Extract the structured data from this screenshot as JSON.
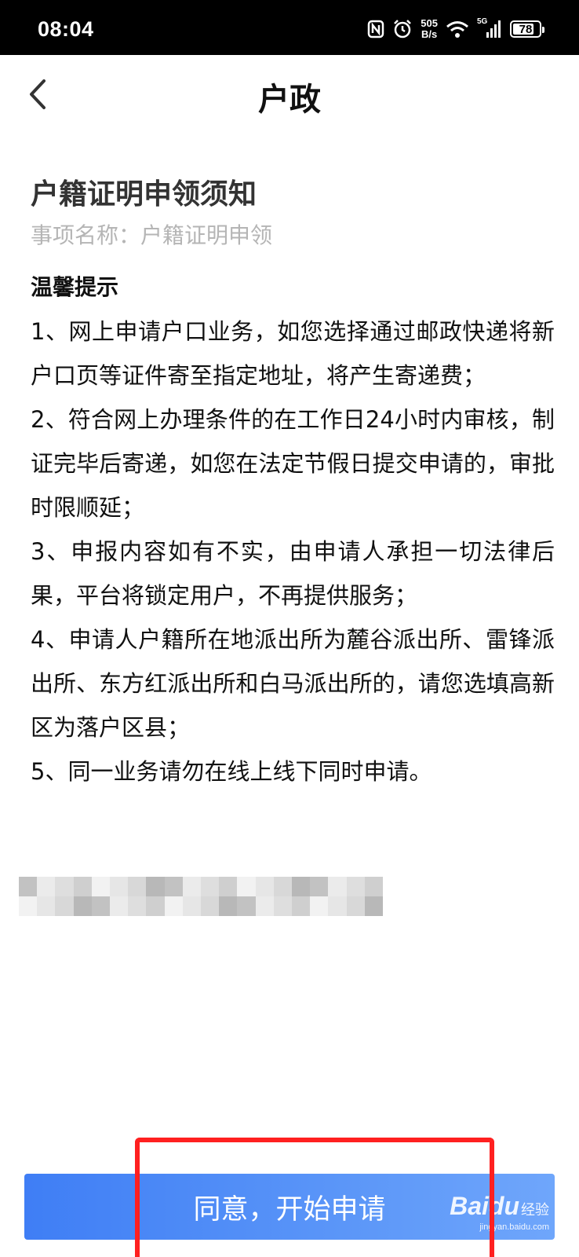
{
  "status_bar": {
    "time": "08:04",
    "net_speed_value": "505",
    "net_speed_unit": "B/s",
    "network_type": "5G",
    "battery_level": "78",
    "icons": [
      "nfc-icon",
      "alarm-icon",
      "wifi-icon",
      "signal-icon",
      "battery-icon"
    ]
  },
  "header": {
    "title": "户政",
    "back_icon": "chevron-left-icon"
  },
  "notice": {
    "title": "户籍证明申领须知",
    "item_name": "事项名称：户籍证明申领",
    "tips_heading": "温馨提示",
    "tips": [
      "1、网上申请户口业务，如您选择通过邮政快递将新户口页等证件寄至指定地址，将产生寄递费；",
      "2、符合网上办理条件的在工作日24小时内审核，制证完毕后寄递，如您在法定节假日提交申请的，审批时限顺延；",
      "3、申报内容如有不实，由申请人承担一切法律后果，平台将锁定用户，不再提供服务；",
      "4、申请人户籍所在地派出所为麓谷派出所、雷锋派出所、东方红派出所和白马派出所的，请您选填高新区为落户区县；",
      "5、同一业务请勿在线上线下同时申请。"
    ]
  },
  "footer": {
    "agree_button_label": "同意，开始申请"
  },
  "watermark": {
    "logo": "Baidu",
    "text": "经验",
    "sub": "jingyan.baidu.com"
  },
  "colors": {
    "button_start": "#3f7ef5",
    "button_end": "#6fa6fb",
    "highlight": "#ff2020",
    "muted_text": "#b5b5b5"
  }
}
